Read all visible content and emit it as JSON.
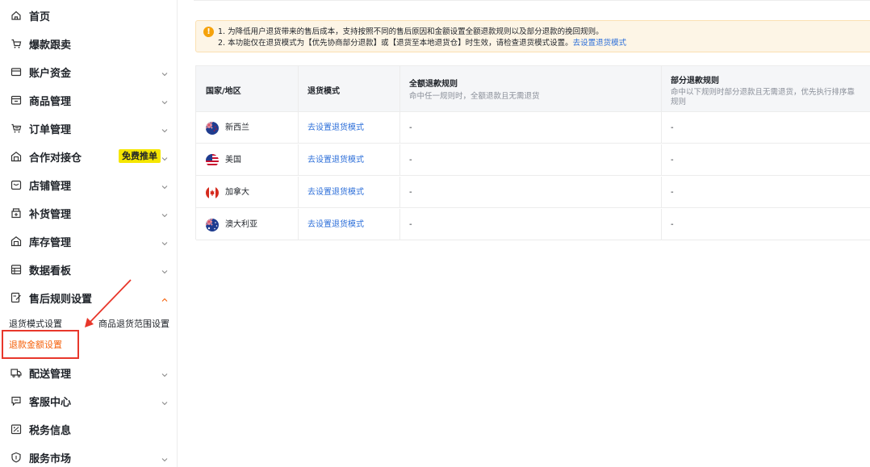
{
  "sidebar": {
    "items": [
      {
        "label": "首页",
        "icon": "home-icon"
      },
      {
        "label": "爆款跟卖",
        "icon": "cart-icon"
      },
      {
        "label": "账户资金",
        "icon": "wallet-icon"
      },
      {
        "label": "商品管理",
        "icon": "product-icon"
      },
      {
        "label": "订单管理",
        "icon": "order-icon"
      },
      {
        "label": "合作对接仓",
        "icon": "warehouse-icon",
        "badge": "免费推单"
      },
      {
        "label": "店铺管理",
        "icon": "shop-icon"
      },
      {
        "label": "补货管理",
        "icon": "restock-icon"
      },
      {
        "label": "库存管理",
        "icon": "inventory-icon"
      },
      {
        "label": "数据看板",
        "icon": "dashboard-icon"
      },
      {
        "label": "售后规则设置",
        "icon": "aftersale-icon"
      },
      {
        "label": "配送管理",
        "icon": "delivery-icon"
      },
      {
        "label": "客服中心",
        "icon": "service-icon"
      },
      {
        "label": "税务信息",
        "icon": "tax-icon"
      },
      {
        "label": "服务市场",
        "icon": "market-icon"
      }
    ],
    "sub_items": {
      "return_mode": "退货模式设置",
      "return_scope": "商品退货范围设置",
      "refund_amount": "退款金额设置"
    }
  },
  "notice": {
    "line1": "1. 为降低用户退货带来的售后成本，支持按照不同的售后原因和金额设置全额退款规则以及部分退款的挽回规则。",
    "line2": "2. 本功能仅在退货模式为【优先协商部分退款】或【退货至本地退货仓】时生效，请检查退货模式设置。",
    "line2_link": "去设置退货模式"
  },
  "table": {
    "headers": {
      "region": "国家/地区",
      "mode": "退货模式",
      "full": "全额退款规则",
      "full_sub": "命中任一规则时，全额退款且无需退货",
      "partial": "部分退款规则",
      "partial_sub1": "命中以下规则时部分退款且无需退货，优先执行排序靠",
      "partial_sub2": "规则"
    },
    "rows": [
      {
        "region": "新西兰",
        "flag": "nz-flag",
        "mode": "去设置退货模式",
        "full": "-",
        "partial": "-"
      },
      {
        "region": "美国",
        "flag": "us-flag",
        "mode": "去设置退货模式",
        "full": "-",
        "partial": "-"
      },
      {
        "region": "加拿大",
        "flag": "ca-flag",
        "mode": "去设置退货模式",
        "full": "-",
        "partial": "-"
      },
      {
        "region": "澳大利亚",
        "flag": "au-flag",
        "mode": "去设置退货模式",
        "full": "-",
        "partial": "-"
      }
    ]
  },
  "colors": {
    "accent": "#f5610b",
    "link": "#2d6fd9",
    "badge": "#f5e600",
    "annotation": "#e8372b"
  }
}
